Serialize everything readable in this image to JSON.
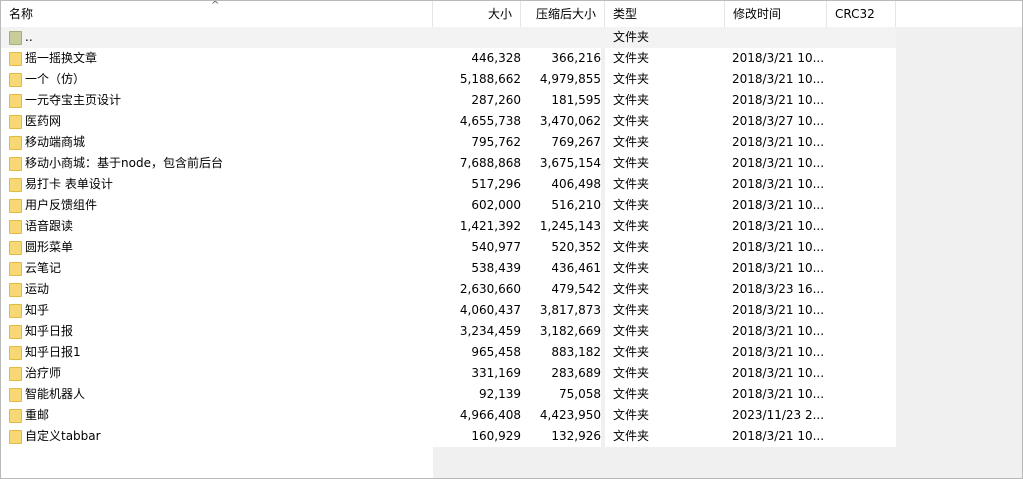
{
  "columns": {
    "name": "名称",
    "size": "大小",
    "packed": "压缩后大小",
    "type": "类型",
    "modified": "修改时间",
    "crc": "CRC32"
  },
  "sort_indicator": "^",
  "parent_row": {
    "name": "..",
    "size": "",
    "packed": "",
    "type": "文件夹",
    "modified": "",
    "crc": ""
  },
  "rows": [
    {
      "name": "摇一摇换文章",
      "size": "446,328",
      "packed": "366,216",
      "type": "文件夹",
      "modified": "2018/3/21 10...",
      "crc": ""
    },
    {
      "name": "一个（仿）",
      "size": "5,188,662",
      "packed": "4,979,855",
      "type": "文件夹",
      "modified": "2018/3/21 10...",
      "crc": ""
    },
    {
      "name": "一元夺宝主页设计",
      "size": "287,260",
      "packed": "181,595",
      "type": "文件夹",
      "modified": "2018/3/21 10...",
      "crc": ""
    },
    {
      "name": "医药网",
      "size": "4,655,738",
      "packed": "3,470,062",
      "type": "文件夹",
      "modified": "2018/3/27 10...",
      "crc": ""
    },
    {
      "name": "移动端商城",
      "size": "795,762",
      "packed": "769,267",
      "type": "文件夹",
      "modified": "2018/3/21 10...",
      "crc": ""
    },
    {
      "name": "移动小商城：基于node，包含前后台",
      "size": "7,688,868",
      "packed": "3,675,154",
      "type": "文件夹",
      "modified": "2018/3/21 10...",
      "crc": ""
    },
    {
      "name": "易打卡 表单设计",
      "size": "517,296",
      "packed": "406,498",
      "type": "文件夹",
      "modified": "2018/3/21 10...",
      "crc": ""
    },
    {
      "name": "用户反馈组件",
      "size": "602,000",
      "packed": "516,210",
      "type": "文件夹",
      "modified": "2018/3/21 10...",
      "crc": ""
    },
    {
      "name": "语音跟读",
      "size": "1,421,392",
      "packed": "1,245,143",
      "type": "文件夹",
      "modified": "2018/3/21 10...",
      "crc": ""
    },
    {
      "name": "圆形菜单",
      "size": "540,977",
      "packed": "520,352",
      "type": "文件夹",
      "modified": "2018/3/21 10...",
      "crc": ""
    },
    {
      "name": "云笔记",
      "size": "538,439",
      "packed": "436,461",
      "type": "文件夹",
      "modified": "2018/3/21 10...",
      "crc": ""
    },
    {
      "name": "运动",
      "size": "2,630,660",
      "packed": "479,542",
      "type": "文件夹",
      "modified": "2018/3/23 16...",
      "crc": ""
    },
    {
      "name": "知乎",
      "size": "4,060,437",
      "packed": "3,817,873",
      "type": "文件夹",
      "modified": "2018/3/21 10...",
      "crc": ""
    },
    {
      "name": "知乎日报",
      "size": "3,234,459",
      "packed": "3,182,669",
      "type": "文件夹",
      "modified": "2018/3/21 10...",
      "crc": ""
    },
    {
      "name": "知乎日报1",
      "size": "965,458",
      "packed": "883,182",
      "type": "文件夹",
      "modified": "2018/3/21 10...",
      "crc": ""
    },
    {
      "name": "治疗师",
      "size": "331,169",
      "packed": "283,689",
      "type": "文件夹",
      "modified": "2018/3/21 10...",
      "crc": ""
    },
    {
      "name": "智能机器人",
      "size": "92,139",
      "packed": "75,058",
      "type": "文件夹",
      "modified": "2018/3/21 10...",
      "crc": ""
    },
    {
      "name": "重邮",
      "size": "4,966,408",
      "packed": "4,423,950",
      "type": "文件夹",
      "modified": "2023/11/23 2...",
      "crc": ""
    },
    {
      "name": "自定义tabbar",
      "size": "160,929",
      "packed": "132,926",
      "type": "文件夹",
      "modified": "2018/3/21 10...",
      "crc": ""
    }
  ]
}
